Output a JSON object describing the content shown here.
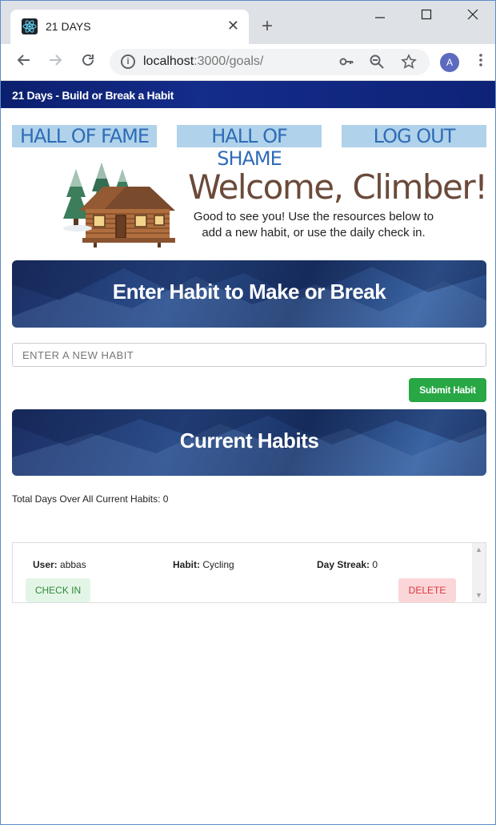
{
  "browser": {
    "tab_title": "21 DAYS",
    "tab_close": "✕",
    "new_tab": "+",
    "url_host": "localhost",
    "url_rest": ":3000/goals/",
    "avatar_initial": "A",
    "icons": [
      "react-favicon",
      "back-arrow-icon",
      "forward-arrow-icon",
      "reload-icon",
      "info-icon",
      "key-icon",
      "zoom-out-icon",
      "star-icon",
      "menu-dots-icon",
      "minimize-icon",
      "maximize-icon",
      "close-icon"
    ]
  },
  "app": {
    "banner_title": "21 Days - Build or Break a Habit",
    "nav": {
      "fame": "HALL OF FAME",
      "shame": "HALL OF SHAME",
      "logout": "LOG OUT"
    },
    "welcome": {
      "title": "Welcome, Climber!",
      "subtitle": "Good to see you! Use the resources below to add a new habit, or use the daily check in."
    },
    "enter_section_title": "Enter Habit to Make or Break",
    "input_placeholder": "ENTER A NEW HABIT",
    "submit_label": "Submit Habit",
    "current_section_title": "Current Habits",
    "total_days_text": "Total Days Over All Current Habits: 0",
    "habits": [
      {
        "user_label": "User:",
        "user": "abbas",
        "habit_label": "Habit:",
        "habit": "Cycling",
        "streak_label": "Day Streak:",
        "streak": "0",
        "checkin_label": "CHECK IN",
        "delete_label": "DELETE"
      }
    ]
  },
  "colors": {
    "banner": "#0e2377",
    "nav_bg": "#b0d2ea",
    "nav_text": "#2f6cb7",
    "submit": "#28a745",
    "checkin_bg": "#e3f5e6",
    "delete_bg": "#fbd6d8"
  }
}
